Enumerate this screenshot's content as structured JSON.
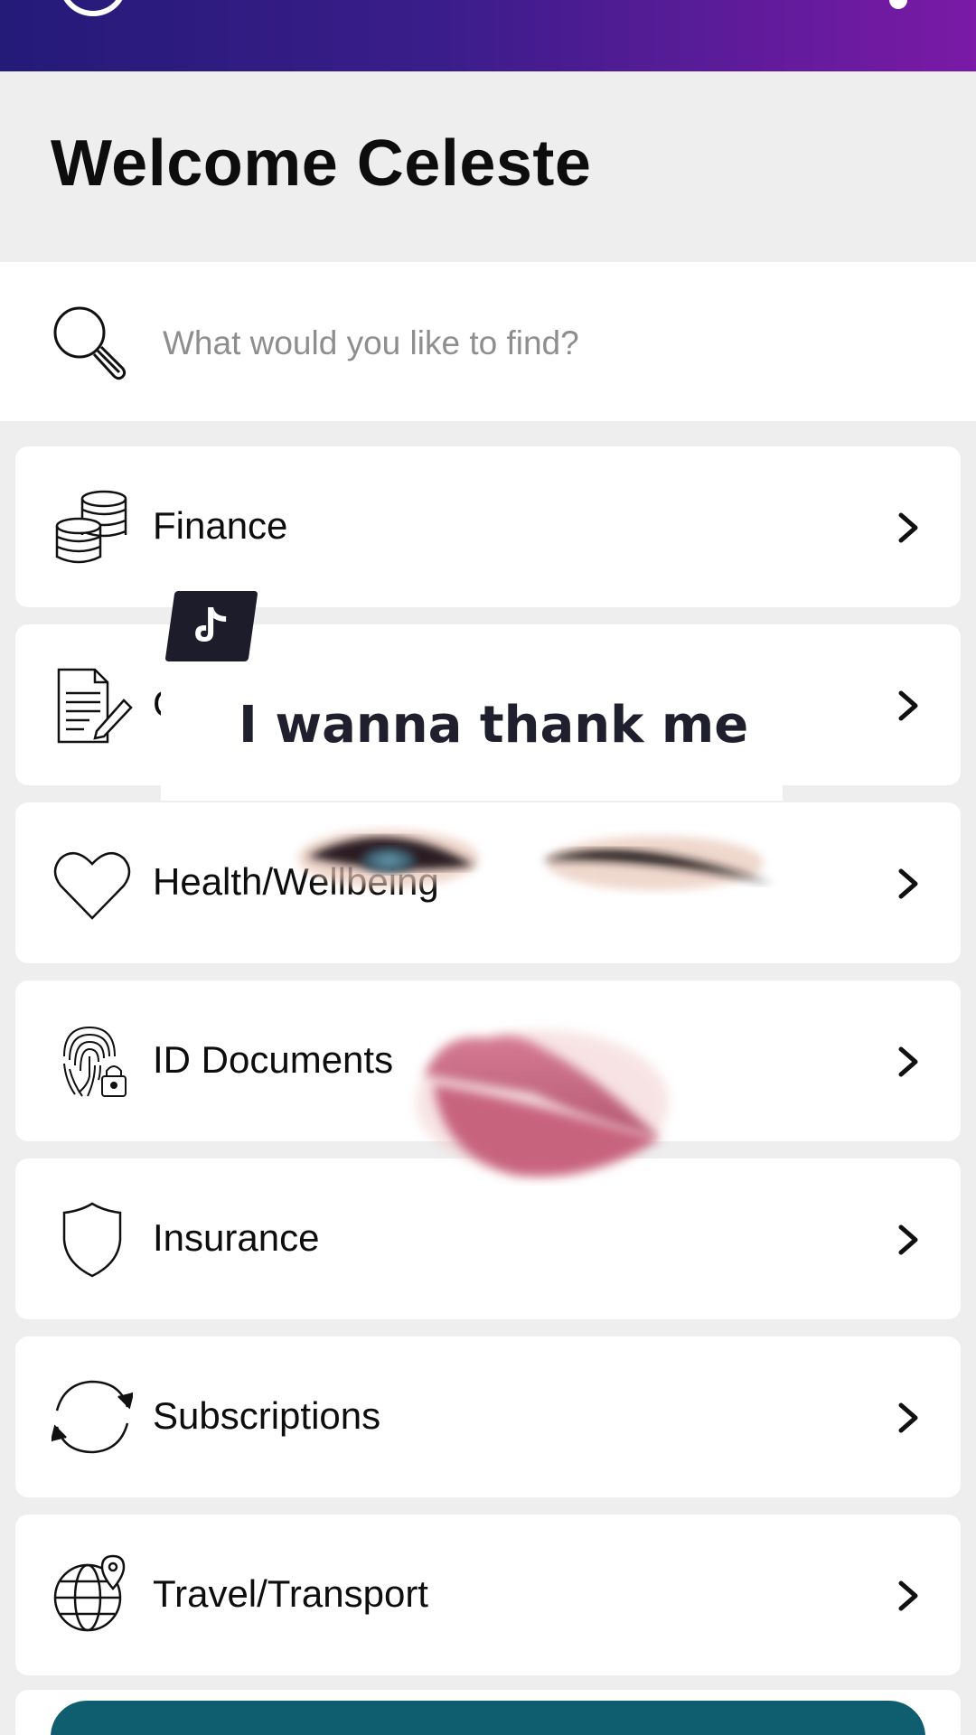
{
  "header": {
    "welcome": "Welcome Celeste"
  },
  "search": {
    "placeholder": "What would you like to find?"
  },
  "categories": [
    {
      "label": "Finance",
      "icon": "coins-icon"
    },
    {
      "label": "G",
      "icon": "document-edit-icon"
    },
    {
      "label": "Health/Wellbeing",
      "icon": "heart-icon"
    },
    {
      "label": "ID Documents",
      "icon": "fingerprint-lock-icon"
    },
    {
      "label": "Insurance",
      "icon": "shield-icon"
    },
    {
      "label": "Subscriptions",
      "icon": "refresh-cycle-icon"
    },
    {
      "label": "Travel/Transport",
      "icon": "globe-pin-icon"
    }
  ],
  "overlay": {
    "caption": "I wanna thank me",
    "badge_icon": "tiktok-icon"
  },
  "colors": {
    "header_start": "#241a78",
    "header_end": "#7a1aa6",
    "bottom_button": "#0f5e70",
    "background": "#eeeeef"
  }
}
